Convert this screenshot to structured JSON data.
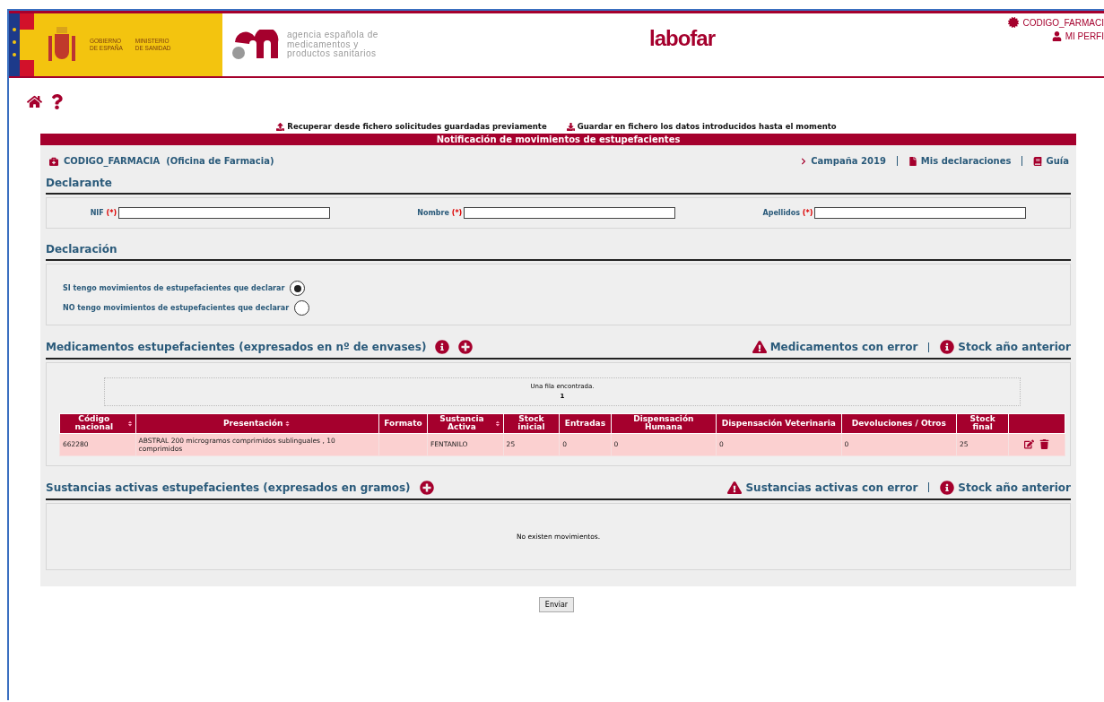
{
  "header": {
    "gov_lines": [
      "GOBIERNO",
      "DE ESPAÑA"
    ],
    "ministry_lines": [
      "MINISTERIO",
      "DE SANIDAD"
    ],
    "agency_lines": [
      "agencia española de",
      "medicamentos y",
      "productos sanitarios"
    ],
    "app_logo": "labofar",
    "user": "CODIGO_FARMACI",
    "profile": "MI PERFI"
  },
  "file_actions": [
    "Recuperar desde fichero solicitudes guardadas previamente",
    "Guardar en fichero los datos introducidos hasta el momento"
  ],
  "panel_title": "Notificación de movimientos de estupefacientes",
  "pharmacy": {
    "code": "CODIGO_FARMACIA",
    "type": "(Oficina de Farmacia)"
  },
  "top_links": [
    {
      "label": "Campaña 2019",
      "kind": "chevron"
    },
    {
      "label": "Mis declaraciones",
      "kind": "doc"
    },
    {
      "label": "Guía",
      "kind": "book"
    }
  ],
  "declarante": {
    "title": "Declarante",
    "required_mark": "(*)",
    "fields": [
      {
        "label": "NIF"
      },
      {
        "label": "Nombre"
      },
      {
        "label": "Apellidos"
      }
    ]
  },
  "declaracion": {
    "title": "Declaración",
    "options": [
      {
        "label": "SI tengo movimientos de estupefacientes que declarar",
        "selected": true
      },
      {
        "label": "NO tengo movimientos de estupefacientes que declarar",
        "selected": false
      }
    ]
  },
  "medicamentos": {
    "title": "Medicamentos estupefacientes (expresados en nº de envases)",
    "links": [
      {
        "label": "Medicamentos con error",
        "kind": "warning"
      },
      {
        "label": "Stock año anterior",
        "kind": "info"
      }
    ],
    "found": "Una fila encontrada.",
    "page": "1",
    "columns": [
      {
        "label": "Código nacional",
        "sortable": true
      },
      {
        "label": "Presentación",
        "sortable": true
      },
      {
        "label": "Formato",
        "sortable": false
      },
      {
        "label": "Sustancia Activa",
        "sortable": true
      },
      {
        "label": "Stock inicial",
        "sortable": false
      },
      {
        "label": "Entradas",
        "sortable": false
      },
      {
        "label": "Dispensación Humana",
        "sortable": false
      },
      {
        "label": "Dispensación Veterinaria",
        "sortable": false
      },
      {
        "label": "Devoluciones / Otros",
        "sortable": false
      },
      {
        "label": "Stock final",
        "sortable": false
      }
    ],
    "rows": [
      [
        "662280",
        "ABSTRAL 200 microgramos comprimidos sublinguales , 10 comprimidos",
        "",
        "FENTANILO",
        "25",
        "0",
        "0",
        "0",
        "0",
        "25"
      ]
    ]
  },
  "sustancias": {
    "title": "Sustancias activas estupefacientes (expresados en gramos)",
    "links": [
      {
        "label": "Sustancias activas con error",
        "kind": "warning"
      },
      {
        "label": "Stock año anterior",
        "kind": "info"
      }
    ],
    "empty": "No existen movimientos."
  },
  "submit": "Enviar"
}
